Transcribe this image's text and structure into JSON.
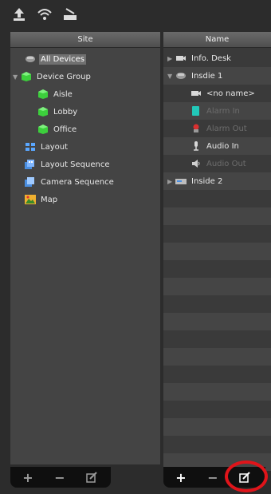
{
  "toolbar": {
    "icons": [
      "upload-icon",
      "wifi-signal-icon",
      "scanner-icon"
    ]
  },
  "left_panel": {
    "header": "Site",
    "items": [
      {
        "label": "All Devices",
        "icon": "devices-icon",
        "selected": true
      },
      {
        "label": "Device Group",
        "icon": "green-cube-icon",
        "expanded": true
      },
      {
        "label": "Aisle",
        "icon": "green-cube-icon"
      },
      {
        "label": "Lobby",
        "icon": "green-cube-icon"
      },
      {
        "label": "Office",
        "icon": "green-cube-icon"
      },
      {
        "label": "Layout",
        "icon": "layout-grid-icon"
      },
      {
        "label": "Layout Sequence",
        "icon": "layout-sequence-icon"
      },
      {
        "label": "Camera Sequence",
        "icon": "camera-sequence-icon"
      },
      {
        "label": "Map",
        "icon": "map-icon"
      }
    ]
  },
  "right_panel": {
    "header": "Name",
    "items": [
      {
        "label": "Info. Desk",
        "icon": "camera-icon",
        "collapsed": true
      },
      {
        "label": "Insdie 1",
        "icon": "device-icon",
        "expanded": true
      },
      {
        "label": "<no name>",
        "icon": "camera-icon"
      },
      {
        "label": "Alarm In",
        "icon": "alarm-in-icon",
        "disabled": true
      },
      {
        "label": "Alarm Out",
        "icon": "alarm-out-icon",
        "disabled": true
      },
      {
        "label": "Audio In",
        "icon": "microphone-icon"
      },
      {
        "label": "Audio Out",
        "icon": "speaker-icon",
        "disabled": true
      },
      {
        "label": "Inside 2",
        "icon": "dvr-icon",
        "collapsed": true
      }
    ]
  },
  "bottom_left": {
    "buttons": [
      "+",
      "−",
      "✎"
    ]
  },
  "bottom_right": {
    "buttons": [
      "+",
      "−",
      "✎"
    ]
  },
  "colors": {
    "highlight_ring": "#e0141a",
    "cube_green": "#3ccf3c",
    "alarm_teal": "#22c8b8"
  }
}
